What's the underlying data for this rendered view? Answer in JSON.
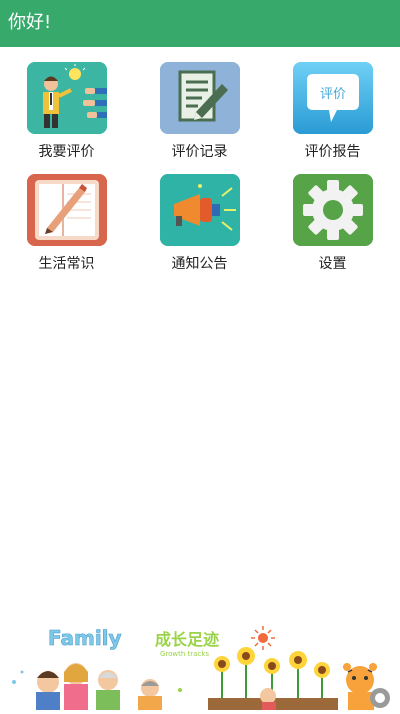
{
  "header": {
    "title": "你好!"
  },
  "menu": [
    {
      "label": "我要评价",
      "icon": "teacher-presentation-icon"
    },
    {
      "label": "评价记录",
      "icon": "notepad-pencil-icon"
    },
    {
      "label": "评价报告",
      "icon": "speech-bubble-icon",
      "bubble_text": "评价"
    },
    {
      "label": "生活常识",
      "icon": "notebook-pencil-icon"
    },
    {
      "label": "通知公告",
      "icon": "megaphone-icon"
    },
    {
      "label": "设置",
      "icon": "gear-icon"
    }
  ],
  "footer": {
    "family_text": "Family",
    "growth_cn": "成长足迹",
    "growth_en": "Growth tracks"
  },
  "colors": {
    "header_bg": "#37a96b",
    "header_text": "#ffffff"
  }
}
